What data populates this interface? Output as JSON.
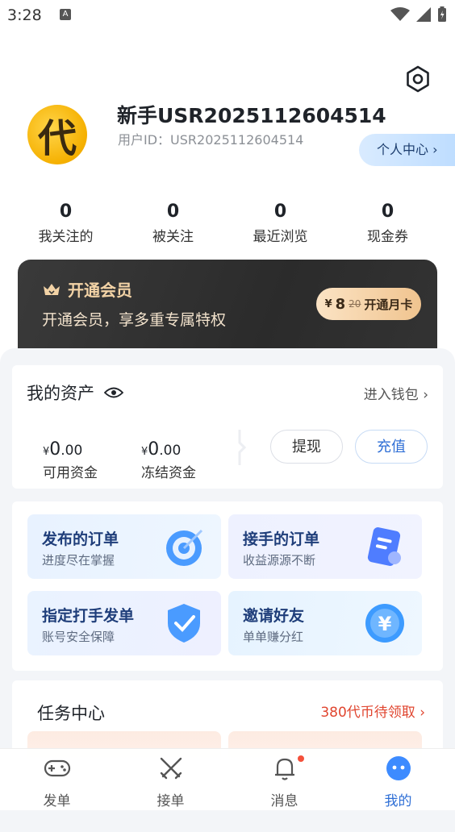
{
  "status": {
    "time": "3:28",
    "a_icon": "A"
  },
  "profile": {
    "avatar_char": "代",
    "username": "新手USR2025112604514",
    "user_id": "用户ID：USR2025112604514",
    "center_button": "个人中心 ›"
  },
  "stats": [
    {
      "value": "0",
      "label": "我关注的"
    },
    {
      "value": "0",
      "label": "被关注"
    },
    {
      "value": "0",
      "label": "最近浏览"
    },
    {
      "value": "0",
      "label": "现金券"
    }
  ],
  "vip": {
    "title": "开通会员",
    "subtitle": "开通会员，享多重专属特权",
    "currency": "¥",
    "price": "8",
    "old_price": "20",
    "button_label": "开通月卡"
  },
  "assets": {
    "title": "我的资产",
    "wallet_link": "进入钱包 ›",
    "available": {
      "currency": "¥",
      "int": "0",
      "dec": ".00",
      "label": "可用资金"
    },
    "frozen": {
      "currency": "¥",
      "int": "0",
      "dec": ".00",
      "label": "冻结资金"
    },
    "withdraw": "提现",
    "recharge": "充值"
  },
  "tiles": [
    {
      "title": "发布的订单",
      "sub": "进度尽在掌握",
      "icon": "target-icon"
    },
    {
      "title": "接手的订单",
      "sub": "收益源源不断",
      "icon": "clipboard-icon"
    },
    {
      "title": "指定打手发单",
      "sub": "账号安全保障",
      "icon": "shield-check-icon"
    },
    {
      "title": "邀请好友",
      "sub": "单单赚分红",
      "icon": "yuan-coin-icon"
    }
  ],
  "tasks": {
    "title": "任务中心",
    "reward_link": "380代币待领取 ›"
  },
  "tabbar": [
    {
      "label": "发单",
      "icon": "gamepad-icon"
    },
    {
      "label": "接单",
      "icon": "crossed-swords-icon"
    },
    {
      "label": "消息",
      "icon": "bell-icon"
    },
    {
      "label": "我的",
      "icon": "chat-bubble-icon"
    }
  ],
  "colors": {
    "accent": "#2f6fd6",
    "vip_gold": "#f3d3a6",
    "reward_red": "#e0452f"
  }
}
